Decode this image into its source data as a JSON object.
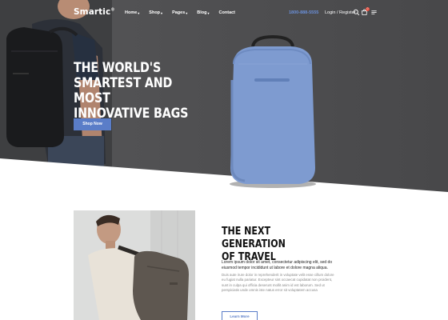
{
  "brand": {
    "logo_text": "Smartic",
    "logo_mark": "®"
  },
  "nav": {
    "items": [
      {
        "label": "Home",
        "has_dropdown": true
      },
      {
        "label": "Shop",
        "has_dropdown": true
      },
      {
        "label": "Pages",
        "has_dropdown": true
      },
      {
        "label": "Blog",
        "has_dropdown": true
      },
      {
        "label": "Contact",
        "has_dropdown": false
      }
    ],
    "dropdown_glyph": "▾",
    "phone": "1800-888-5555",
    "login_register": "Login / Register",
    "cart_count": "0",
    "icons": [
      "search-icon",
      "cart-icon",
      "menu-icon"
    ]
  },
  "hero": {
    "title_lines": [
      "THE WORLD'S",
      "SMARTEST AND MOST",
      "INNOVATIVE BAGS"
    ],
    "cta_label": "Shop Now"
  },
  "feature": {
    "title_lines": [
      "THE NEXT GENERATION",
      "OF TRAVEL"
    ],
    "lead": "Lorem ipsum dolor sit amet, consectetur adipiscing elit, sed do eiusmod tempor incididunt ut labore et dolore magna aliqua.",
    "body": "Duis aute irure dolor in reprehenderit in voluptate velit esse cillum dolore eu fugiat nulla pariatur. Excepteur sint occaecat cupidatat non proident, sunt in culpa qui officia deserunt mollit anim id est laborum. Sed ut perspiciatis unde omnis iste natus error sit voluptatem accusa",
    "cta_label": "Learn More"
  },
  "colors": {
    "accent": "#5a7dc8",
    "hero_bg": "#4f4f51",
    "bag_blue": "#7e9bd0",
    "badge": "#e74c3c"
  }
}
